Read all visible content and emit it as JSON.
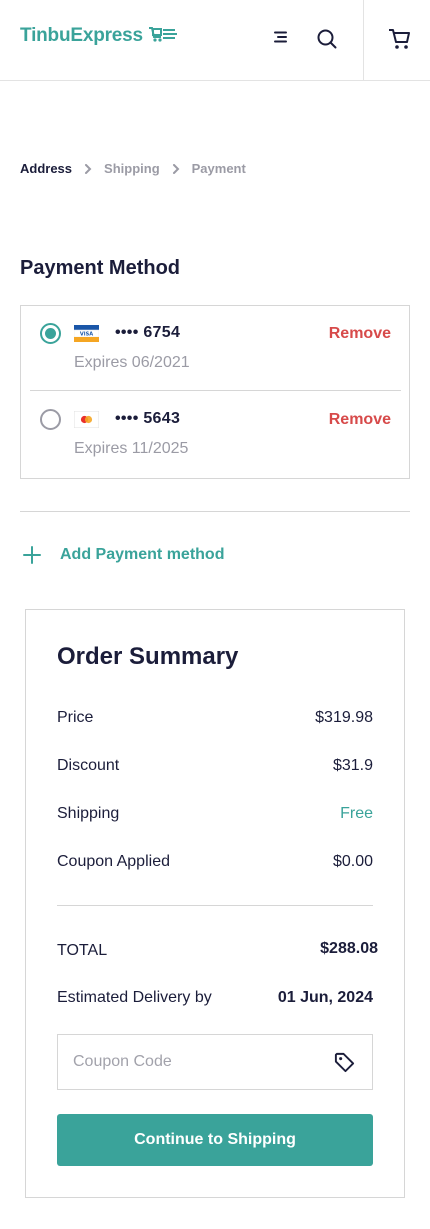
{
  "header": {
    "logo_text": "TinbuExpress",
    "brand_color": "#3aa39a",
    "icons": [
      "cart-logo-icon",
      "menu-icon",
      "search-icon",
      "cart-icon"
    ]
  },
  "breadcrumb": {
    "items": [
      "Address",
      "Shipping",
      "Payment"
    ]
  },
  "payment": {
    "title": "Payment Method",
    "cards": [
      {
        "brand": "visa",
        "brand_label": "VISA",
        "number": "•••• 6754",
        "expires": "Expires 06/2021",
        "selected": true,
        "remove_label": "Remove"
      },
      {
        "brand": "mastercard",
        "number": "•••• 5643",
        "expires": "Expires 11/2025",
        "selected": false,
        "remove_label": "Remove"
      }
    ],
    "add_label": "Add Payment method"
  },
  "summary": {
    "title": "Order Summary",
    "rows": [
      {
        "label": "Price",
        "value": "$319.98"
      },
      {
        "label": "Discount",
        "value": "$31.9"
      },
      {
        "label": "Shipping",
        "value": "Free"
      },
      {
        "label": "Coupon Applied",
        "value": "$0.00"
      }
    ],
    "total_label": "TOTAL",
    "total_value": "$288.08",
    "delivery_label": "Estimated Delivery by",
    "delivery_value": "01 Jun, 2024",
    "coupon_placeholder": "Coupon Code",
    "continue_label": "Continue to Shipping"
  },
  "colors": {
    "accent": "#3aa39a",
    "danger": "#d74a4a",
    "text": "#1b1d3a",
    "muted": "#9b9ba5"
  }
}
